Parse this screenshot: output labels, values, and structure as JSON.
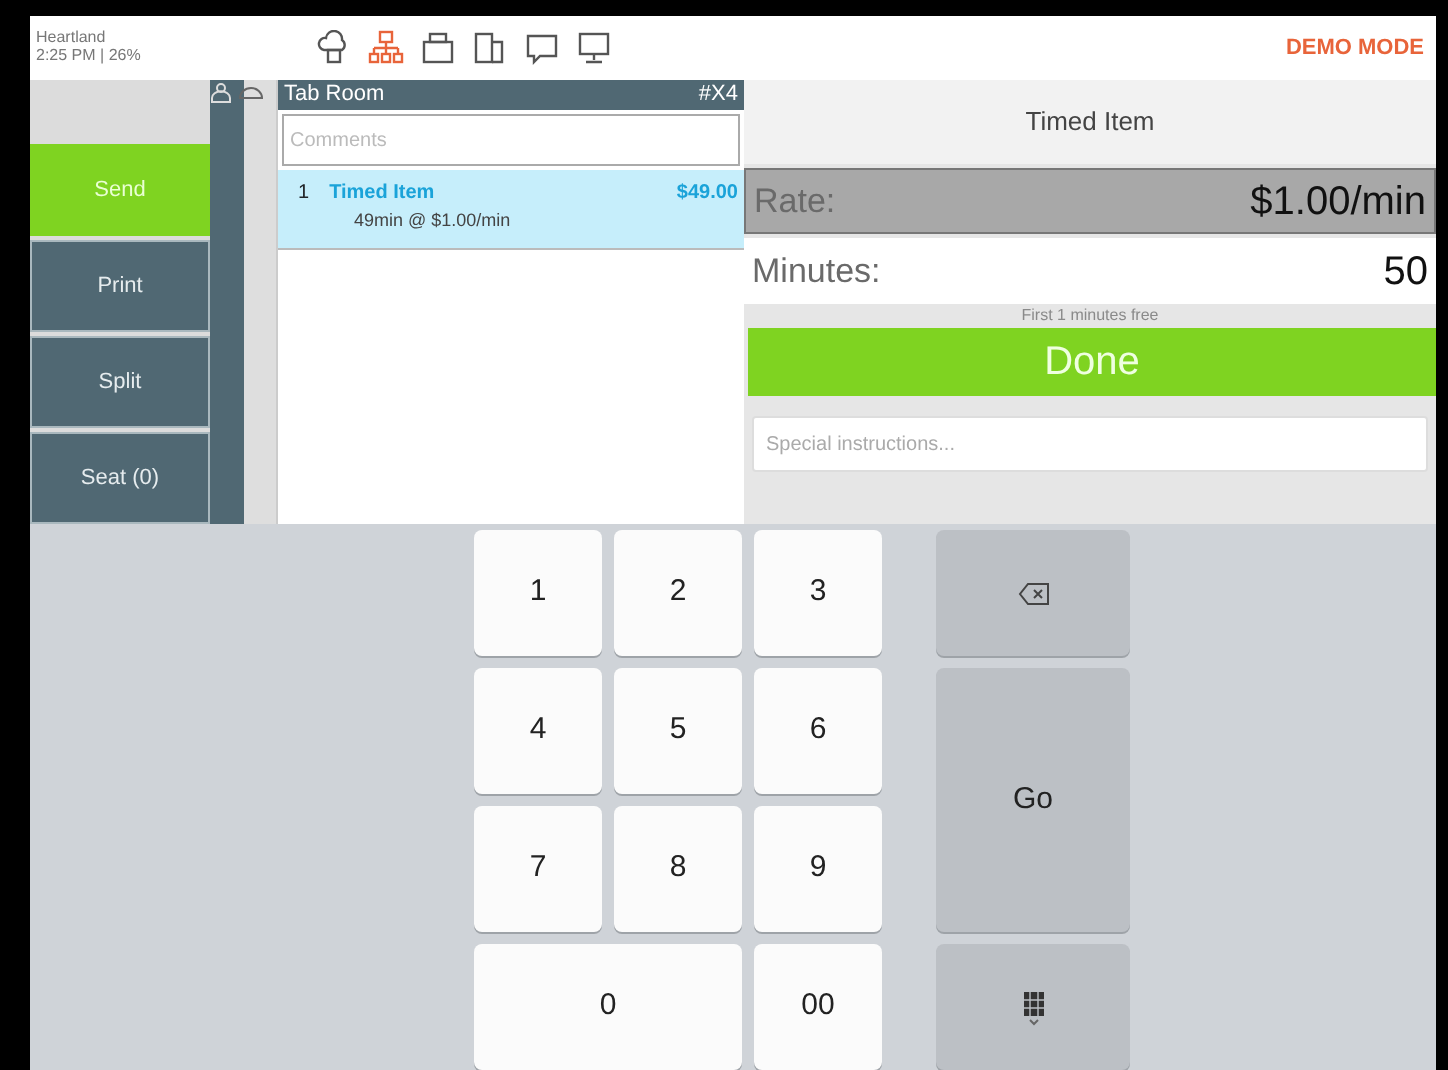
{
  "status": {
    "brand": "Heartland",
    "time_battery": "2:25 PM  |  26%"
  },
  "toolbar_icons": [
    {
      "color": "#555555"
    },
    {
      "color": "#e8643a"
    },
    {
      "color": "#555555"
    },
    {
      "color": "#555555"
    },
    {
      "color": "#555555"
    },
    {
      "color": "#555555"
    }
  ],
  "mode": "DEMO MODE",
  "actions": [
    {
      "label": "Send",
      "highlighted": true
    },
    {
      "label": "Print",
      "highlighted": false
    },
    {
      "label": "Split",
      "highlighted": false
    },
    {
      "label": "Seat (0)",
      "highlighted": false
    }
  ],
  "order": {
    "room": "Tab Room",
    "tab": "#X4",
    "comments_placeholder": "Comments",
    "items": [
      {
        "qty": "1",
        "name": "Timed Item",
        "detail": "49min  @ $1.00/min",
        "price": "$49.00",
        "selected": true
      }
    ]
  },
  "editor": {
    "title": "Timed Item",
    "rate_label": "Rate:",
    "rate": "$1.00/min",
    "minutes_label": "Minutes:",
    "minutes": "50",
    "note": "First 1 minutes free",
    "done": "Done",
    "instructions_placeholder": "Special instructions..."
  },
  "keypad": [
    {
      "kind": "digit",
      "label": "1"
    },
    {
      "kind": "digit",
      "label": "2"
    },
    {
      "kind": "digit",
      "label": "3"
    },
    {
      "kind": "backspace"
    },
    {
      "kind": "digit",
      "label": "4"
    },
    {
      "kind": "digit",
      "label": "5"
    },
    {
      "kind": "digit",
      "label": "6"
    },
    {
      "kind": "go",
      "label": "Go"
    },
    {
      "kind": "digit",
      "label": "7"
    },
    {
      "kind": "digit",
      "label": "8"
    },
    {
      "kind": "digit",
      "label": "9"
    },
    {
      "kind": "digit",
      "label": "0"
    },
    {
      "kind": "digit",
      "label": "00"
    },
    {
      "kind": "keyboard"
    }
  ]
}
